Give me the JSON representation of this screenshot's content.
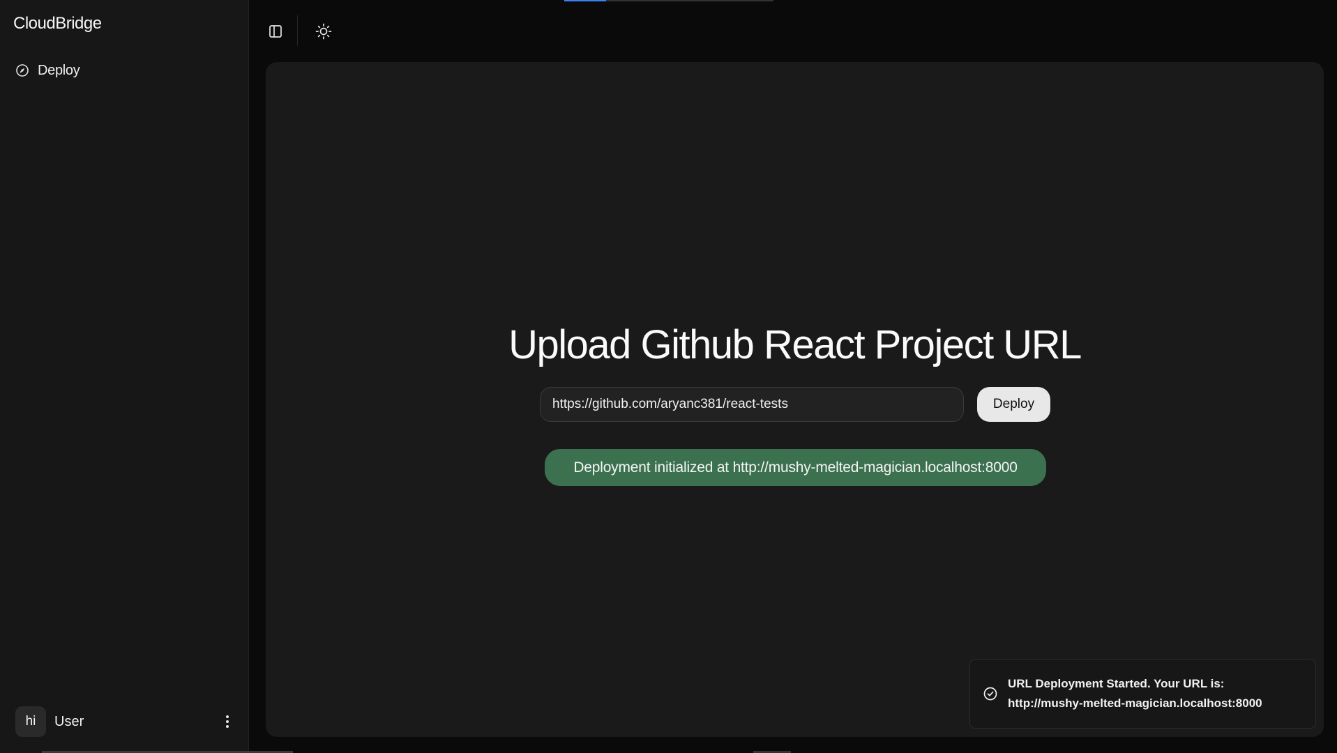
{
  "sidebar": {
    "brand": "CloudBridge",
    "items": [
      {
        "label": "Deploy",
        "icon": "gauge-icon"
      }
    ],
    "user": {
      "avatar_text": "hi",
      "name": "User"
    }
  },
  "topbar": {
    "toggle_icon": "sidebar-toggle-icon",
    "theme_icon": "sun-icon"
  },
  "main": {
    "heading": "Upload Github React Project URL",
    "url_input_value": "https://github.com/aryanc381/react-tests",
    "deploy_button_label": "Deploy",
    "status_message": "Deployment initialized at http://mushy-melted-magician.localhost:8000"
  },
  "toast": {
    "line1": "URL Deployment Started. Your URL is:",
    "line2": "http://mushy-melted-magician.localhost:8000",
    "icon": "check-circle-icon"
  },
  "colors": {
    "background": "#0a0a0a",
    "sidebar": "#171717",
    "panel": "#1a1a1a",
    "success": "#3c7150",
    "button": "#e8e8e8"
  }
}
